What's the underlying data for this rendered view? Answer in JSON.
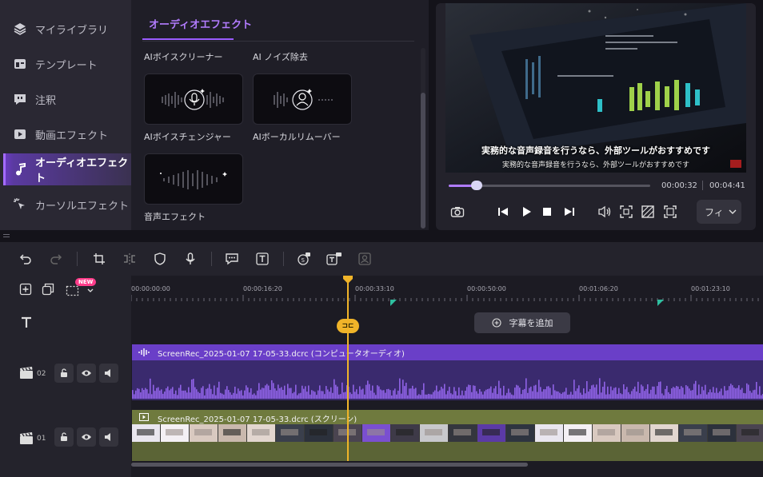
{
  "sidebar": {
    "items": [
      {
        "label": "マイライブラリ",
        "icon": "layers-icon"
      },
      {
        "label": "テンプレート",
        "icon": "template-icon"
      },
      {
        "label": "注釈",
        "icon": "annotation-icon"
      },
      {
        "label": "動画エフェクト",
        "icon": "video-effect-icon"
      },
      {
        "label": "オーディオエフェクト",
        "icon": "music-note-icon",
        "active": true
      },
      {
        "label": "カーソルエフェクト",
        "icon": "cursor-effect-icon"
      }
    ]
  },
  "effects": {
    "tab": "オーディオエフェクト",
    "items": [
      {
        "label": "AIボイスクリーナー"
      },
      {
        "label": "AI ノイズ除去"
      },
      {
        "label": "AIボイスチェンジャー"
      },
      {
        "label": "AIボーカルリムーバー"
      },
      {
        "label": "音声エフェクト"
      }
    ]
  },
  "preview": {
    "subtitle_main": "実務的な音声録音を行うなら、外部ツールがおすすめです",
    "subtitle_secondary": "実務的な音声録音を行うなら、外部ツールがおすすめです",
    "current_time": "00:00:32",
    "total_time": "00:04:41",
    "progress": 0.14,
    "fit_label": "フィ"
  },
  "timeline": {
    "ruler": [
      "00:00:00:00",
      "00:00:16:20",
      "00:00:33:10",
      "00:00:50:00",
      "00:01:06:20",
      "00:01:23:10"
    ],
    "new_badge": "NEW",
    "add_subtitle": "字幕を追加",
    "tracks": [
      {
        "number": "02",
        "clip_title": "ScreenRec_2025-01-07 17-05-33.dcrc (コンピュータオーディオ)"
      },
      {
        "number": "01",
        "clip_title": "ScreenRec_2025-01-07 17-05-33.dcrc (スクリーン)"
      }
    ],
    "split_label": "⊐⊏"
  },
  "colors": {
    "accent": "#9b5cff",
    "playhead": "#f0b429",
    "audio_clip": "#6a3fc8",
    "video_clip": "#6f7a3e"
  }
}
